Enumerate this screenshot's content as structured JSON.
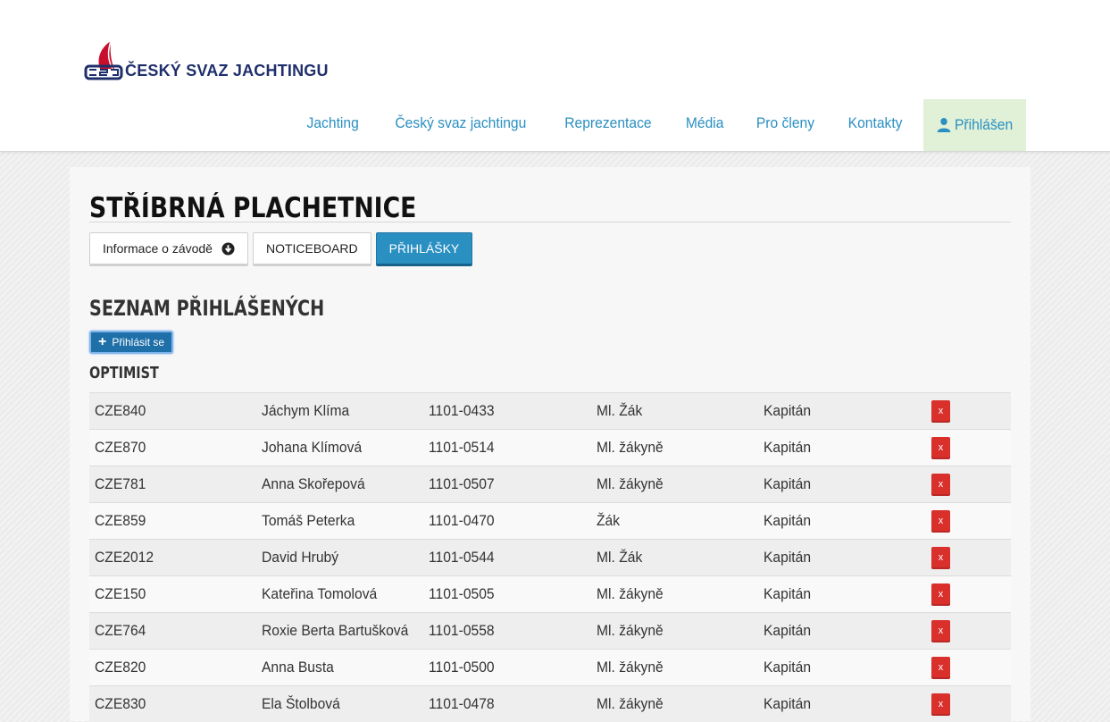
{
  "header": {
    "logo_text": "ČESKÝ SVAZ JACHTINGU",
    "nav": [
      {
        "label": "Jachting"
      },
      {
        "label": "Český svaz jachtingu"
      },
      {
        "label": "Reprezentace"
      },
      {
        "label": "Média"
      },
      {
        "label": "Pro členy"
      },
      {
        "label": "Kontakty"
      }
    ],
    "login_label": "Přihlášen"
  },
  "page": {
    "title": "STŘÍBRNÁ PLACHETNICE",
    "tabs": [
      {
        "label": "Informace o závodě",
        "icon": "arrow-down-circle-icon",
        "active": false
      },
      {
        "label": "NOTICEBOARD",
        "active": false
      },
      {
        "label": "PŘIHLÁŠKY",
        "active": true
      }
    ],
    "section_title": "SEZNAM PŘIHLÁŠENÝCH",
    "signup_label": "Přihlásit se",
    "class_title": "OPTIMIST",
    "delete_label": "x"
  },
  "entries": [
    {
      "sail": "CZE840",
      "name": "Jáchym Klíma",
      "id": "1101-0433",
      "category": "Ml. Žák",
      "role": "Kapitán"
    },
    {
      "sail": "CZE870",
      "name": "Johana Klímová",
      "id": "1101-0514",
      "category": "Ml. žákyně",
      "role": "Kapitán"
    },
    {
      "sail": "CZE781",
      "name": "Anna Skořepová",
      "id": "1101-0507",
      "category": "Ml. žákyně",
      "role": "Kapitán"
    },
    {
      "sail": "CZE859",
      "name": "Tomáš Peterka",
      "id": "1101-0470",
      "category": "Žák",
      "role": "Kapitán"
    },
    {
      "sail": "CZE2012",
      "name": "David Hrubý",
      "id": "1101-0544",
      "category": "Ml. Žák",
      "role": "Kapitán"
    },
    {
      "sail": "CZE150",
      "name": "Kateřina Tomolová",
      "id": "1101-0505",
      "category": "Ml. žákyně",
      "role": "Kapitán"
    },
    {
      "sail": "CZE764",
      "name": "Roxie Berta Bartušková",
      "id": "1101-0558",
      "category": "Ml. žákyně",
      "role": "Kapitán"
    },
    {
      "sail": "CZE820",
      "name": "Anna Busta",
      "id": "1101-0500",
      "category": "Ml. žákyně",
      "role": "Kapitán"
    },
    {
      "sail": "CZE830",
      "name": "Ela Štolbová",
      "id": "1101-0478",
      "category": "Ml. žákyně",
      "role": "Kapitán"
    }
  ],
  "colors": {
    "nav_link": "#2a8fc1",
    "login_bg": "#e0f1d8",
    "active_tab": "#2a8fc1",
    "delete_button": "#d9302c",
    "logo_navy": "#1f2f6b"
  }
}
